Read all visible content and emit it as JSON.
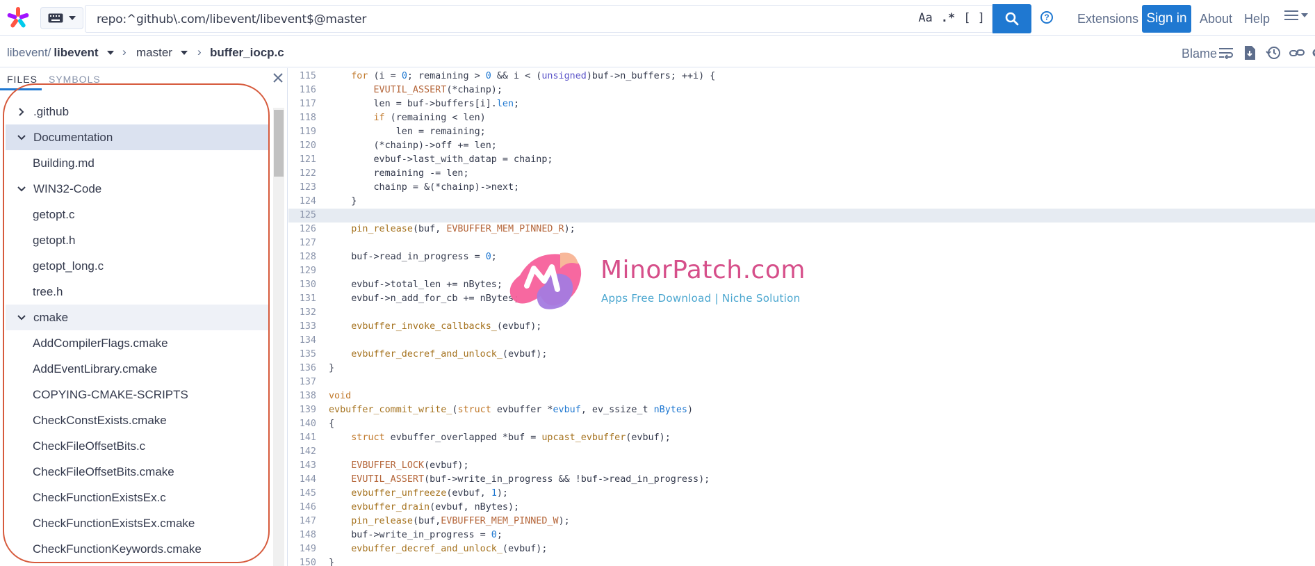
{
  "header": {
    "query": "repo:^github\\.com/libevent/libevent$@master",
    "toggle_case": "Aa",
    "toggle_regex": ".*",
    "toggle_structural": "[ ]",
    "extensions": "Extensions",
    "sign_in": "Sign in",
    "about": "About",
    "help": "Help"
  },
  "breadcrumb": {
    "org": "libevent/",
    "repo": "libevent",
    "branch": "master",
    "file": "buffer_iocp.c",
    "blame": "Blame"
  },
  "sidebar": {
    "tab_files": "FILES",
    "tab_symbols": "SYMBOLS",
    "tree": [
      {
        "name": ".github",
        "type": "dir",
        "open": false
      },
      {
        "name": "Documentation",
        "type": "dir",
        "open": true,
        "selected": true
      },
      {
        "name": "Building.md",
        "type": "file"
      },
      {
        "name": "WIN32-Code",
        "type": "dir",
        "open": true
      },
      {
        "name": "getopt.c",
        "type": "file"
      },
      {
        "name": "getopt.h",
        "type": "file"
      },
      {
        "name": "getopt_long.c",
        "type": "file"
      },
      {
        "name": "tree.h",
        "type": "file"
      },
      {
        "name": "cmake",
        "type": "dir",
        "open": true,
        "shaded": true
      },
      {
        "name": "AddCompilerFlags.cmake",
        "type": "file"
      },
      {
        "name": "AddEventLibrary.cmake",
        "type": "file"
      },
      {
        "name": "COPYING-CMAKE-SCRIPTS",
        "type": "file"
      },
      {
        "name": "CheckConstExists.cmake",
        "type": "file"
      },
      {
        "name": "CheckFileOffsetBits.c",
        "type": "file"
      },
      {
        "name": "CheckFileOffsetBits.cmake",
        "type": "file"
      },
      {
        "name": "CheckFunctionExistsEx.c",
        "type": "file"
      },
      {
        "name": "CheckFunctionExistsEx.cmake",
        "type": "file"
      },
      {
        "name": "CheckFunctionKeywords.cmake",
        "type": "file"
      }
    ]
  },
  "code": {
    "highlighted_line": 125,
    "lines": [
      {
        "n": 115,
        "html": "    <span class=\"kw\">for</span> (i = <span class=\"nm\">0</span>; remaining > <span class=\"nm\">0</span> && i < (<span class=\"ty\">unsigned</span>)buf->n_buffers; ++i) {"
      },
      {
        "n": 116,
        "html": "        <span class=\"mc\">EVUTIL_ASSERT</span>(*chainp);"
      },
      {
        "n": 117,
        "html": "        len = buf->buffers[i].<span class=\"nm\">len</span>;"
      },
      {
        "n": 118,
        "html": "        <span class=\"kw\">if</span> (remaining < len)"
      },
      {
        "n": 119,
        "html": "            len = remaining;"
      },
      {
        "n": 120,
        "html": "        (*chainp)->off += len;"
      },
      {
        "n": 121,
        "html": "        evbuf->last_with_datap = chainp;"
      },
      {
        "n": 122,
        "html": "        remaining -= len;"
      },
      {
        "n": 123,
        "html": "        chainp = &(*chainp)->next;"
      },
      {
        "n": 124,
        "html": "    }"
      },
      {
        "n": 125,
        "html": ""
      },
      {
        "n": 126,
        "html": "    <span class=\"fn\">pin_release</span>(buf, <span class=\"mc\">EVBUFFER_MEM_PINNED_R</span>);"
      },
      {
        "n": 127,
        "html": ""
      },
      {
        "n": 128,
        "html": "    buf->read_in_progress = <span class=\"nm\">0</span>;"
      },
      {
        "n": 129,
        "html": ""
      },
      {
        "n": 130,
        "html": "    evbuf->total_len += nBytes;"
      },
      {
        "n": 131,
        "html": "    evbuf->n_add_for_cb += nBytes;"
      },
      {
        "n": 132,
        "html": ""
      },
      {
        "n": 133,
        "html": "    <span class=\"fn\">evbuffer_invoke_callbacks_</span>(evbuf);"
      },
      {
        "n": 134,
        "html": ""
      },
      {
        "n": 135,
        "html": "    <span class=\"fn\">evbuffer_decref_and_unlock_</span>(evbuf);"
      },
      {
        "n": 136,
        "html": "}"
      },
      {
        "n": 137,
        "html": ""
      },
      {
        "n": 138,
        "html": "<span class=\"kw\">void</span>"
      },
      {
        "n": 139,
        "html": "<span class=\"fn\">evbuffer_commit_write_</span>(<span class=\"kw\">struct</span> evbuffer *<span class=\"nm\">evbuf</span>, ev_ssize_t <span class=\"nm\">nBytes</span>)"
      },
      {
        "n": 140,
        "html": "{"
      },
      {
        "n": 141,
        "html": "    <span class=\"kw\">struct</span> evbuffer_overlapped *buf = <span class=\"fn\">upcast_evbuffer</span>(evbuf);"
      },
      {
        "n": 142,
        "html": ""
      },
      {
        "n": 143,
        "html": "    <span class=\"mc\">EVBUFFER_LOCK</span>(evbuf);"
      },
      {
        "n": 144,
        "html": "    <span class=\"mc\">EVUTIL_ASSERT</span>(buf->write_in_progress && !buf->read_in_progress);"
      },
      {
        "n": 145,
        "html": "    <span class=\"fn\">evbuffer_unfreeze</span>(evbuf, <span class=\"nm\">1</span>);"
      },
      {
        "n": 146,
        "html": "    <span class=\"fn\">evbuffer_drain</span>(evbuf, nBytes);"
      },
      {
        "n": 147,
        "html": "    <span class=\"fn\">pin_release</span>(buf,<span class=\"mc\">EVBUFFER_MEM_PINNED_W</span>);"
      },
      {
        "n": 148,
        "html": "    buf->write_in_progress = <span class=\"nm\">0</span>;"
      },
      {
        "n": 149,
        "html": "    <span class=\"fn\">evbuffer_decref_and_unlock_</span>(evbuf);"
      },
      {
        "n": 150,
        "html": "}"
      }
    ]
  },
  "watermark": {
    "title": "MinorPatch.com",
    "subtitle": "Apps Free Download | Niche Solution"
  },
  "colors": {
    "accent": "#1f78d1",
    "annotation_oval": "#d65a3c",
    "selected_row": "#dbe2f0"
  }
}
